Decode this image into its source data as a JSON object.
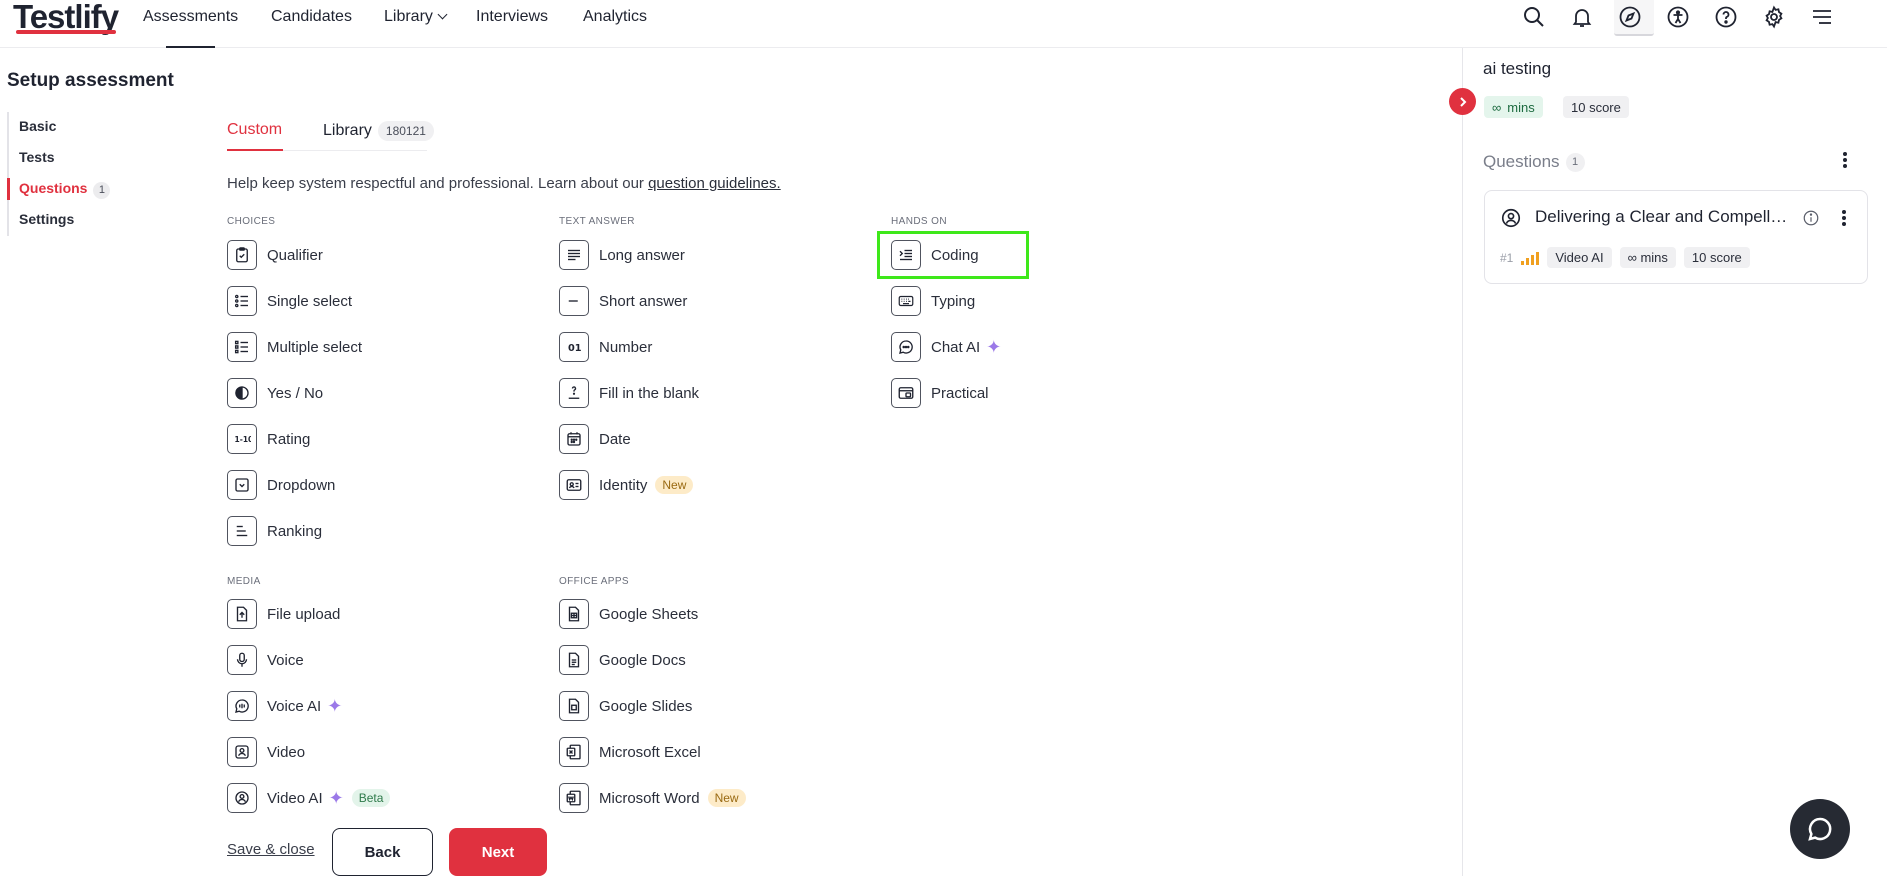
{
  "brand": {
    "logo_text": "Testlify",
    "accent": "#e0313f"
  },
  "topnav": {
    "items": [
      {
        "label": "Assessments"
      },
      {
        "label": "Candidates"
      },
      {
        "label": "Library"
      },
      {
        "label": "Interviews"
      },
      {
        "label": "Analytics"
      }
    ],
    "icons": [
      "search-icon",
      "bell-icon",
      "compass-icon",
      "accessibility-icon",
      "help-icon",
      "gear-icon",
      "menu-icon"
    ]
  },
  "page": {
    "title": "Setup assessment",
    "steps": [
      {
        "label": "Basic"
      },
      {
        "label": "Tests"
      },
      {
        "label": "Questions",
        "count": "1"
      },
      {
        "label": "Settings"
      }
    ]
  },
  "tabs": {
    "custom": "Custom",
    "library": "Library",
    "library_count": "180121"
  },
  "help": {
    "text": "Help keep system respectful and professional. Learn about our ",
    "link": "question guidelines."
  },
  "sections": {
    "choices": "CHOICES",
    "text_answer": "TEXT ANSWER",
    "hands_on": "HANDS ON",
    "media": "MEDIA",
    "office_apps": "OFFICE APPS"
  },
  "question_types": {
    "choices": [
      "Qualifier",
      "Single select",
      "Multiple select",
      "Yes / No",
      "Rating",
      "Dropdown",
      "Ranking"
    ],
    "text_answer": [
      "Long answer",
      "Short answer",
      "Number",
      "Fill in the blank",
      "Date",
      "Identity"
    ],
    "hands_on": [
      "Coding",
      "Typing",
      "Chat AI",
      "Practical"
    ],
    "media": [
      "File upload",
      "Voice",
      "Voice AI",
      "Video",
      "Video AI"
    ],
    "office_apps": [
      "Google Sheets",
      "Google Docs",
      "Google Slides",
      "Microsoft Excel",
      "Microsoft Word"
    ]
  },
  "badges": {
    "new": "New",
    "beta": "Beta"
  },
  "footer": {
    "save_close": "Save & close",
    "back": "Back",
    "next": "Next"
  },
  "right_panel": {
    "title": "ai testing",
    "duration": "mins",
    "score": "10 score",
    "questions_label": "Questions",
    "questions_count": "1",
    "card": {
      "title": "Delivering a Clear and Compelling Message",
      "number": "#1",
      "type": "Video AI",
      "duration": "mins",
      "score": "10 score"
    }
  }
}
